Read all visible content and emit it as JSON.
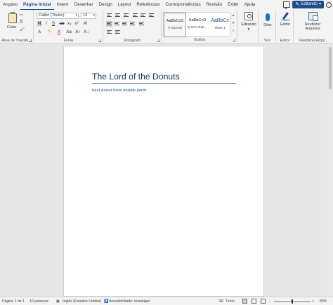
{
  "tabs": [
    "Arquivo",
    "Página Inicial",
    "Inserir",
    "Desenhar",
    "Design",
    "Layout",
    "Referências",
    "Correspondências",
    "Revisão",
    "Exibir",
    "Ajuda"
  ],
  "active_tab": "Página Inicial",
  "mode_button": "Editando",
  "clipboard": {
    "paste_label": "Colar",
    "group_label": "Área de Transfe..."
  },
  "font": {
    "family": "Calibri (Títulos)",
    "size": "13",
    "group_label": "Fonte"
  },
  "paragraph": {
    "group_label": "Parágrafo"
  },
  "styles": {
    "items": [
      {
        "sample": "AaBbCcD",
        "name": "¶ Normal"
      },
      {
        "sample": "AaBbCcD",
        "name": "¶ Sem Esp..."
      },
      {
        "sample": "AaBbCc",
        "name": "Título 1"
      }
    ],
    "group_label": "Estilos"
  },
  "editing": {
    "label": "Editando"
  },
  "dictate": {
    "label": "Ditar",
    "group_label": "Voz"
  },
  "editor": {
    "label": "Editor",
    "group_label": "Editor"
  },
  "reuse": {
    "label_line1": "Reutilizar",
    "label_line2": "Arquivos",
    "group_label": "Reutilizar Arqui..."
  },
  "document": {
    "title": "The Lord of the Donuts",
    "subtitle": "best donut from middle earth"
  },
  "status": {
    "page": "Página 1 de 1",
    "words": "10 palavras",
    "language": "Inglês (Estados Unidos)",
    "accessibility": "Acessibilidade: investigar",
    "focus": "Foco",
    "zoom": "80%"
  },
  "colors": {
    "accent": "#1e4e8c",
    "title": "#17365d",
    "subtitle": "#4f81bd"
  }
}
